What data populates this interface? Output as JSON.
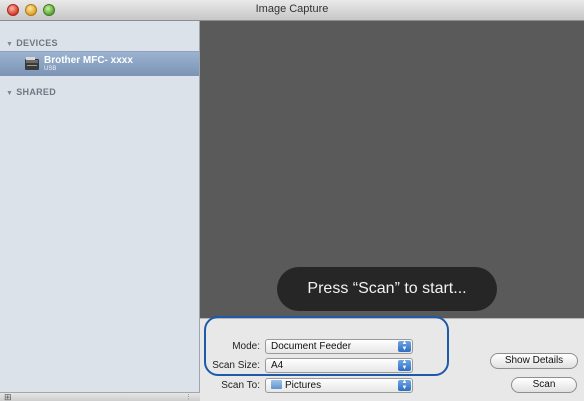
{
  "window": {
    "title": "Image Capture"
  },
  "sidebar": {
    "devices_header": "DEVICES",
    "shared_header": "SHARED",
    "device": {
      "name": "Brother MFC- xxxx",
      "connection": "USB"
    }
  },
  "preview": {
    "hud_message": "Press “Scan” to start..."
  },
  "controls": {
    "mode_label": "Mode:",
    "mode_value": "Document Feeder",
    "scan_size_label": "Scan Size:",
    "scan_size_value": "A4",
    "scan_to_label": "Scan To:",
    "scan_to_value": "Pictures",
    "show_details_label": "Show Details",
    "scan_label": "Scan"
  },
  "icons": {
    "disclosure": "disclosure-triangle-icon",
    "device": "scanner-icon",
    "folder": "folder-icon",
    "popup_arrows": "popup-arrows-icon",
    "add": "plus-icon",
    "resize": "resize-handle-icon"
  },
  "colors": {
    "sidebar_bg": "#dbe2ea",
    "selection": "#7b94b5",
    "preview_bg": "#5a5a5a",
    "highlight_ring": "#1e5aa8"
  }
}
